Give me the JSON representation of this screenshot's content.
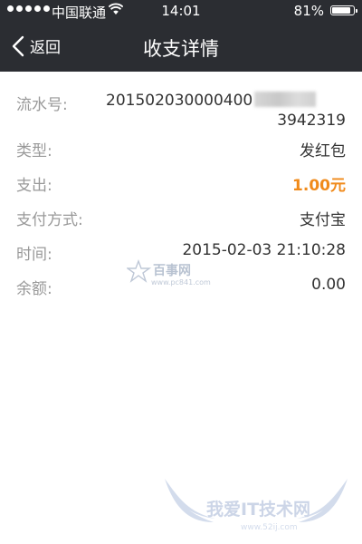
{
  "status_bar": {
    "carrier": "中国联通",
    "time": "14:01",
    "battery": "81%",
    "battery_level": 0.81,
    "signal_bars": 5
  },
  "nav": {
    "back_label": "返回",
    "title": "收支详情",
    "back_icon": "chevron-left-icon"
  },
  "details": {
    "serial": {
      "label": "流水号:",
      "value_line1": "201502030000400",
      "value_line2": "3942319"
    },
    "type": {
      "label": "类型:",
      "value": "发红包"
    },
    "expense": {
      "label": "支出:",
      "value": "1.00元"
    },
    "pay_method": {
      "label": "支付方式:",
      "value": "支付宝"
    },
    "time": {
      "label": "时间:",
      "value": "2015-02-03 21:10:28"
    },
    "balance": {
      "label": "余额:",
      "value": "0.00"
    }
  },
  "watermarks": {
    "center_text": "百事网",
    "center_url": "www.pc841.com",
    "bottom_text": "我爱IT技术网",
    "bottom_url": "www.52ij.com"
  },
  "colors": {
    "bar_background": "#2b2d32",
    "amount": "#f08a1a",
    "label": "#999999",
    "value": "#333333"
  }
}
